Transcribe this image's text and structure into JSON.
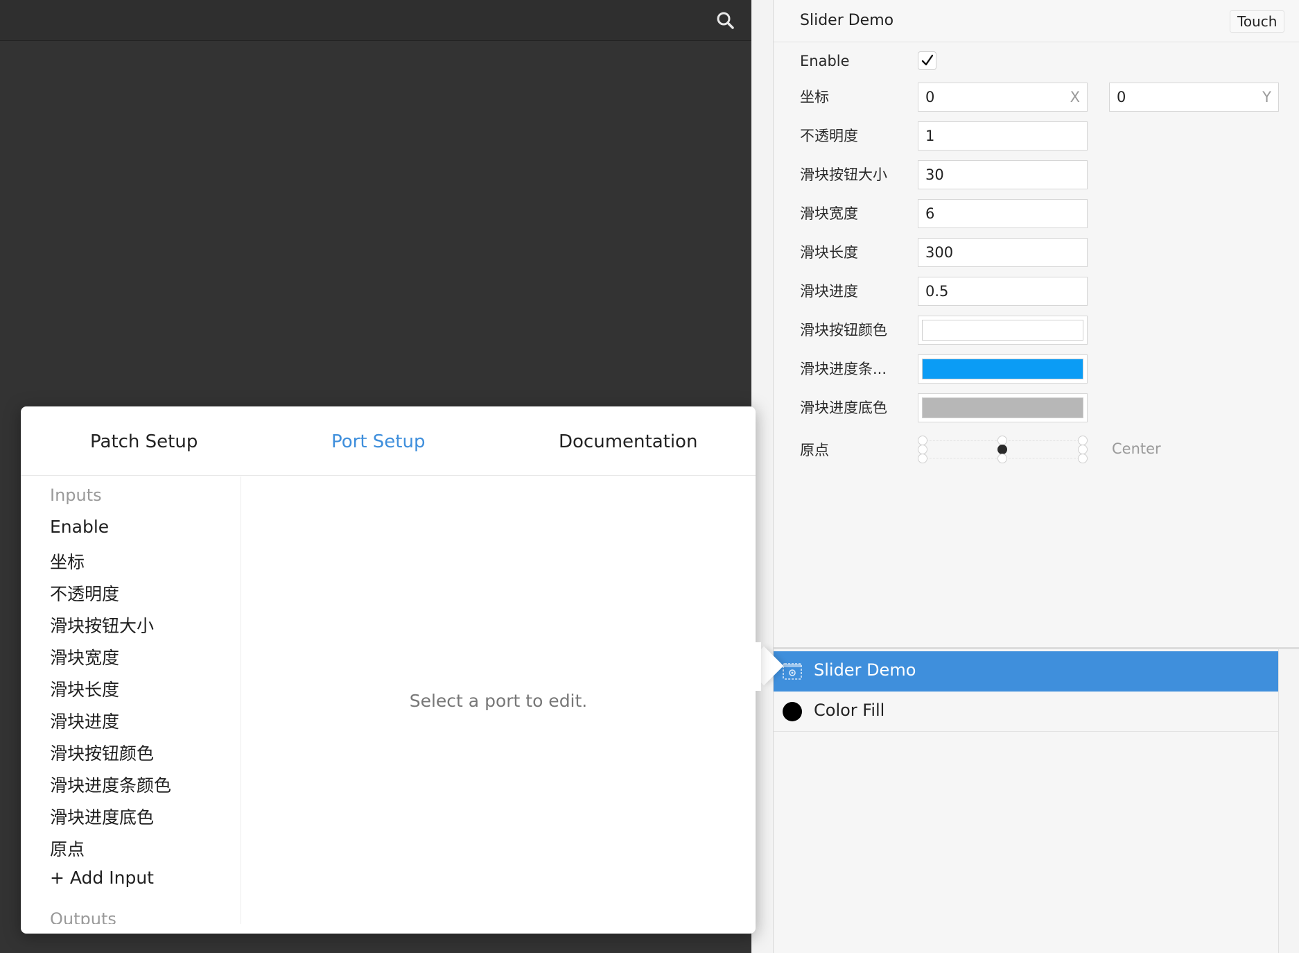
{
  "canvas": {
    "search_icon": "magnifier"
  },
  "inspector": {
    "title": "Slider Demo",
    "touch_label": "Touch",
    "enable_label": "Enable",
    "enable_checked": true,
    "position": {
      "label": "坐标",
      "x": "0",
      "x_suffix": "X",
      "y": "0",
      "y_suffix": "Y"
    },
    "opacity": {
      "label": "不透明度",
      "value": "1"
    },
    "knob_size": {
      "label": "滑块按钮大小",
      "value": "30"
    },
    "slider_width": {
      "label": "滑块宽度",
      "value": "6"
    },
    "slider_length": {
      "label": "滑块长度",
      "value": "300"
    },
    "slider_progress": {
      "label": "滑块进度",
      "value": "0.5"
    },
    "knob_color": {
      "label": "滑块按钮颜色",
      "color": "#ffffff"
    },
    "progress_color": {
      "label": "滑块进度条...",
      "color": "#0b9cf5"
    },
    "track_color": {
      "label": "滑块进度底色",
      "color": "#b7b7b7"
    },
    "anchor": {
      "label": "原点",
      "value": "Center"
    }
  },
  "layers": [
    {
      "label": "Slider Demo",
      "icon": "patch-icon",
      "selected": true
    },
    {
      "label": "Color Fill",
      "icon": "color-fill-icon",
      "selected": false
    }
  ],
  "popover": {
    "tabs": [
      "Patch Setup",
      "Port Setup",
      "Documentation"
    ],
    "active_tab": "Port Setup",
    "inputs_heading": "Inputs",
    "inputs": [
      "Enable",
      "坐标",
      "不透明度",
      "滑块按钮大小",
      "滑块宽度",
      "滑块长度",
      "滑块进度",
      "滑块按钮颜色",
      "滑块进度条颜色",
      "滑块进度底色",
      "原点"
    ],
    "add_input": "+ Add Input",
    "outputs_heading": "Outputs",
    "empty_message": "Select a port to edit."
  },
  "colors": {
    "accent": "#3f8fdc",
    "canvas": "#333333"
  }
}
